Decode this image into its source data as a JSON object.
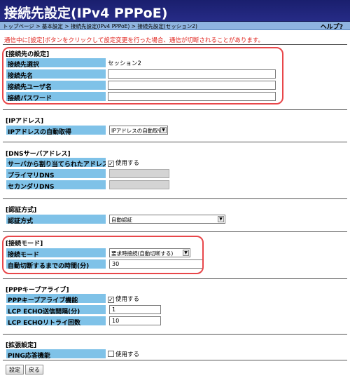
{
  "title": "接続先設定(IPv4 PPPoE)",
  "breadcrumb": "トップページ > 基本設定 > 接続先設定(IPv4 PPPoE) > 接続先設定(セッション2)",
  "help": "ヘルプ?",
  "warning": "通信中に[設定]ボタンをクリックして設定変更を行った場合、通信が切断されることがあります。",
  "sections": {
    "connection": {
      "title": "[接続先の設定]",
      "select_label": "接続先選択",
      "select_value": "セッション2",
      "name_label": "接続先名",
      "name_value": "",
      "user_label": "接続先ユーザ名",
      "user_value": "",
      "password_label": "接続パスワード",
      "password_value": ""
    },
    "ip": {
      "title": "[IPアドレス]",
      "auto_label": "IPアドレスの自動取得",
      "auto_value": "IPアドレスの自動取得"
    },
    "dns": {
      "title": "[DNSサーバアドレス]",
      "server_label": "サーバから割り当てられたアドレス",
      "server_check": "使用する",
      "primary_label": "プライマリDNS",
      "secondary_label": "セカンダリDNS"
    },
    "auth": {
      "title": "[認証方式]",
      "method_label": "認証方式",
      "method_value": "自動認証"
    },
    "mode": {
      "title": "[接続モード]",
      "mode_label": "接続モード",
      "mode_value": "要求時接続(自動切断する)",
      "timeout_label": "自動切断するまでの時間(分)",
      "timeout_value": "30"
    },
    "keepalive": {
      "title": "[PPPキープアライブ]",
      "function_label": "PPPキープアライブ機能",
      "function_check": "使用する",
      "interval_label": "LCP ECHO送信間隔(分)",
      "interval_value": "1",
      "retry_label": "LCP ECHOリトライ回数",
      "retry_value": "10"
    },
    "extended": {
      "title": "[拡張設定]",
      "ping_label": "PING応答機能",
      "ping_check": "使用する"
    }
  },
  "buttons": {
    "save": "設定",
    "back": "戻る"
  },
  "colors": {
    "title_bg": "#1a1f6e",
    "breadcrumb_bg": "#8fb4e0",
    "label_bg": "#7fc2e8",
    "warning": "#e0211b",
    "highlight": "#e8474a"
  }
}
